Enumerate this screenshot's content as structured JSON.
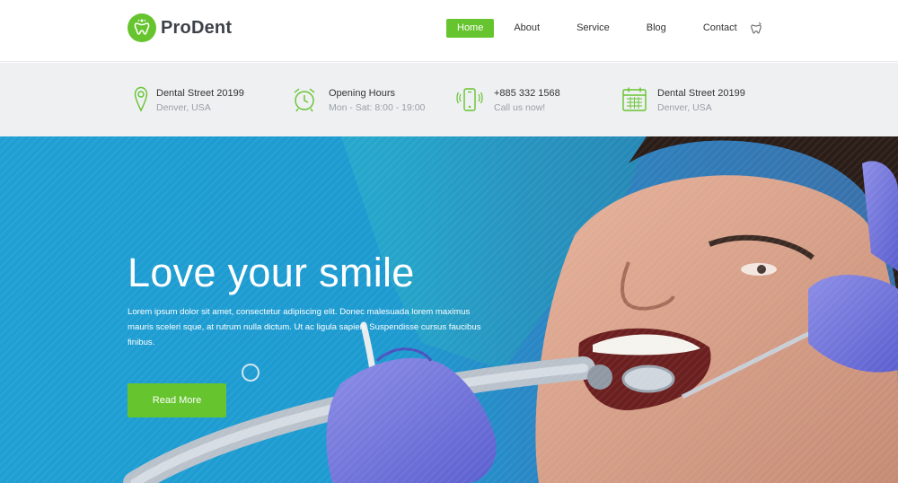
{
  "brand": {
    "name": "ProDent",
    "accent": "#66c42e"
  },
  "nav": {
    "items": [
      {
        "label": "Home",
        "active": true
      },
      {
        "label": "About"
      },
      {
        "label": "Service"
      },
      {
        "label": "Blog"
      },
      {
        "label": "Contact"
      }
    ],
    "icon": "tooth-icon"
  },
  "info": [
    {
      "icon": "location-pin-icon",
      "title": "Dental Street 20199",
      "subtitle": "Denver, USA"
    },
    {
      "icon": "alarm-clock-icon",
      "title": "Opening Hours",
      "subtitle": "Mon - Sat: 8:00 - 19:00"
    },
    {
      "icon": "phone-icon",
      "title": "+885 332 1568",
      "subtitle": "Call us now!"
    },
    {
      "icon": "calendar-icon",
      "title": "Dental Street 20199",
      "subtitle": "Denver, USA"
    }
  ],
  "hero": {
    "title": "Love your smile",
    "text": "Lorem ipsum dolor sit amet, consectetur adipiscing elit. Donec malesuada lorem maximus mauris sceleri sque, at rutrum nulla dictum. Ut ac ligula sapien. Suspendisse cursus faucibus finibus.",
    "button_label": "Read More",
    "image": "dentist-patient-photo"
  }
}
